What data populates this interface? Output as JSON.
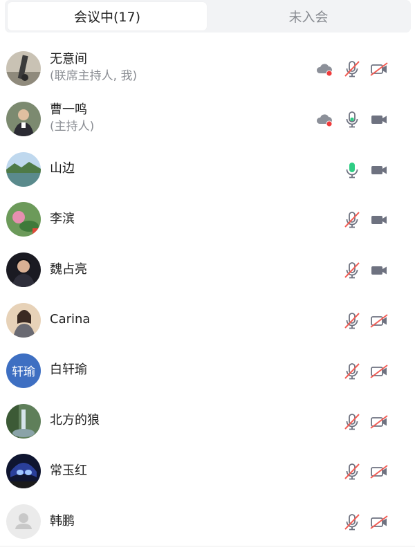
{
  "tabs": {
    "in_meeting": "会议中(17)",
    "not_joined": "未入会"
  },
  "colors": {
    "muted_red": "#f25c54",
    "active_green": "#2fcd84",
    "record_red": "#f03b3b",
    "icon_gray": "#6e7280"
  },
  "participants": [
    {
      "name": "无意间",
      "role": "(联席主持人, 我)",
      "recording": true,
      "mic": "muted",
      "camera": "off"
    },
    {
      "name": "曹一鸣",
      "role": "(主持人)",
      "recording": true,
      "mic": "on",
      "camera": "on"
    },
    {
      "name": "山边",
      "role": "",
      "recording": false,
      "mic": "speaking",
      "camera": "on"
    },
    {
      "name": "李滨",
      "role": "",
      "recording": false,
      "mic": "muted",
      "camera": "on"
    },
    {
      "name": "魏占亮",
      "role": "",
      "recording": false,
      "mic": "muted",
      "camera": "on"
    },
    {
      "name": "Carina",
      "role": "",
      "recording": false,
      "mic": "muted",
      "camera": "off"
    },
    {
      "name": "白轩瑜",
      "role": "",
      "recording": false,
      "mic": "muted",
      "camera": "off",
      "avatar_text": "轩瑜"
    },
    {
      "name": "北方的狼",
      "role": "",
      "recording": false,
      "mic": "muted",
      "camera": "off"
    },
    {
      "name": "常玉红",
      "role": "",
      "recording": false,
      "mic": "muted",
      "camera": "off"
    },
    {
      "name": "韩鹏",
      "role": "",
      "recording": false,
      "mic": "muted",
      "camera": "off"
    }
  ]
}
